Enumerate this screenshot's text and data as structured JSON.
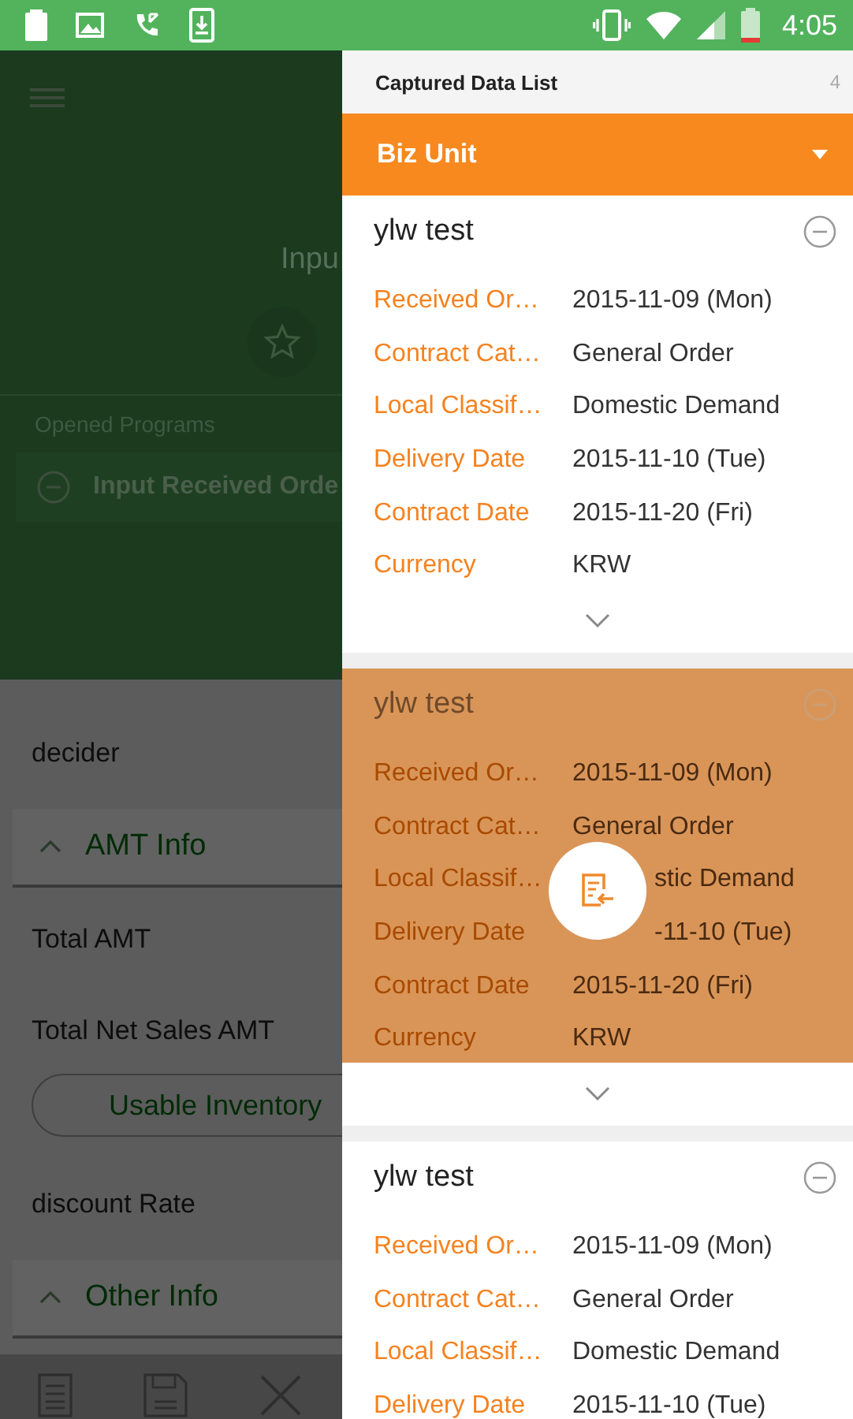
{
  "status_bar": {
    "time": "4:05"
  },
  "background_screen": {
    "title": "Inpu",
    "opened_programs_label": "Opened Programs",
    "opened_program": "Input Received Orde",
    "fields": [
      {
        "kind": "field",
        "label": "decider"
      },
      {
        "kind": "section",
        "label": "AMT Info",
        "expanded": true
      },
      {
        "kind": "field",
        "label": "Total AMT"
      },
      {
        "kind": "field",
        "label": "Total Net Sales AMT"
      },
      {
        "kind": "button",
        "label": "Usable Inventory"
      },
      {
        "kind": "field",
        "label": "discount Rate"
      },
      {
        "kind": "section",
        "label": "Other Info",
        "expanded": true
      }
    ]
  },
  "drawer": {
    "title": "Captured Data List",
    "count": "4",
    "filter": "Biz Unit",
    "cards": [
      {
        "title": "ylw test",
        "selected": false,
        "expand_toggle": true,
        "fields": [
          {
            "label": "Received Or…",
            "value": "2015-11-09 (Mon)"
          },
          {
            "label": "Contract Cat…",
            "value": "General Order"
          },
          {
            "label": "Local Classif…",
            "value": "Domestic Demand"
          },
          {
            "label": "Delivery Date",
            "value": "2015-11-10 (Tue)"
          },
          {
            "label": "Contract Date",
            "value": "2015-11-20 (Fri)"
          },
          {
            "label": "Currency",
            "value": "KRW"
          }
        ]
      },
      {
        "title": "ylw test",
        "selected": true,
        "expand_toggle": true,
        "fields": [
          {
            "label": "Received Or…",
            "value": "2015-11-09 (Mon)"
          },
          {
            "label": "Contract Cat…",
            "value": "General Order"
          },
          {
            "label": "Local Classif…",
            "value": "stic Demand"
          },
          {
            "label": "Delivery Date",
            "value": "-11-10 (Tue)"
          },
          {
            "label": "Contract Date",
            "value": "2015-11-20 (Fri)"
          },
          {
            "label": "Currency",
            "value": "KRW"
          }
        ]
      },
      {
        "title": "ylw test",
        "selected": false,
        "fields": [
          {
            "label": "Received Or…",
            "value": "2015-11-09 (Mon)"
          },
          {
            "label": "Contract Cat…",
            "value": "General Order"
          },
          {
            "label": "Local Classif…",
            "value": "Domestic Demand"
          },
          {
            "label": "Delivery Date",
            "value": "2015-11-10 (Tue)"
          }
        ]
      }
    ]
  }
}
